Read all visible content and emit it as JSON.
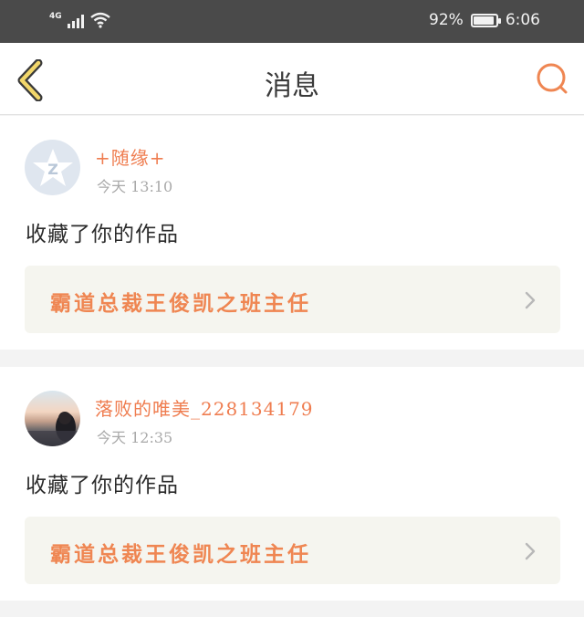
{
  "status_bar": {
    "network": "4G",
    "battery_percent": "92%",
    "battery_level": 0.92,
    "time": "6:06"
  },
  "nav": {
    "back_icon": "chevron-left-icon",
    "title": "消息",
    "search_icon": "search-icon"
  },
  "colors": {
    "accent": "#ef7d50",
    "back_stroke": "#f2d76a",
    "header_bg": "#4a4a4a",
    "card_bg": "#ffffff",
    "work_bg": "#f5f5ef"
  },
  "notifications": [
    {
      "username": "+随缘+",
      "timestamp": "今天 13:10",
      "action": "收藏了你的作品",
      "work_title": "霸道总裁王俊凯之班主任",
      "avatar": "default-avatar-icon"
    },
    {
      "username": "落败的唯美_228134179",
      "timestamp": "今天 12:35",
      "action": "收藏了你的作品",
      "work_title": "霸道总裁王俊凯之班主任",
      "avatar": "user-photo"
    }
  ]
}
